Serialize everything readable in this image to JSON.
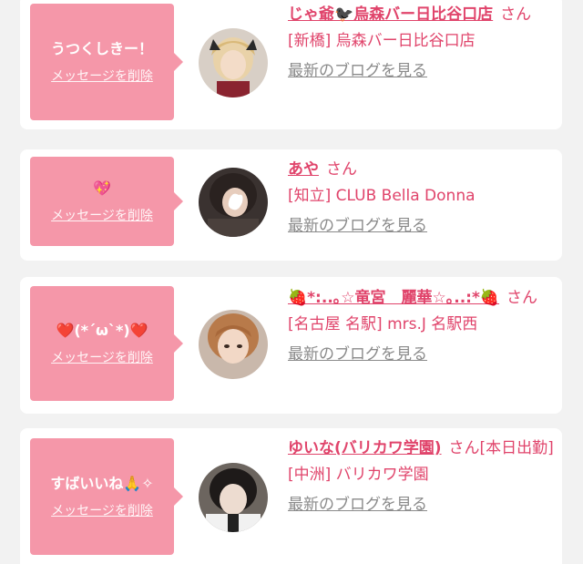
{
  "messages": [
    {
      "bubble_text": "うつくしきー！",
      "delete_label": "メッセージを削除",
      "name": "じゃ爺🐦‍⬛烏森バー日比谷口店",
      "honorific": "さん",
      "status": "",
      "shop": "[新橋] 烏森バー日比谷口店",
      "blog_label": "最新のブログを見る"
    },
    {
      "bubble_text": "💖",
      "delete_label": "メッセージを削除",
      "name": "あや",
      "honorific": "さん",
      "status": "",
      "shop": "[知立] CLUB Bella Donna",
      "blog_label": "最新のブログを見る"
    },
    {
      "bubble_text": "❤️(*´ω`*)❤️",
      "delete_label": "メッセージを削除",
      "name": "🍓*:..｡☆竜宮　麗華☆｡..:*🍓",
      "honorific": "さん",
      "status": "",
      "shop": "[名古屋 名駅] mrs.J 名駅西",
      "blog_label": "最新のブログを見る"
    },
    {
      "bubble_text": "すばいいね🙏✧",
      "delete_label": "メッセージを削除",
      "name": "ゆいな(バリカワ学園)",
      "honorific": "さん",
      "status": "[本日出勤]",
      "shop": "[中洲] バリカワ学園",
      "blog_label": "最新のブログを見る"
    }
  ],
  "colors": {
    "bubble": "#f597a9",
    "accent": "#e0446b",
    "blog_link": "#8a8a8a",
    "background": "#f2f2f2",
    "card": "#ffffff"
  }
}
